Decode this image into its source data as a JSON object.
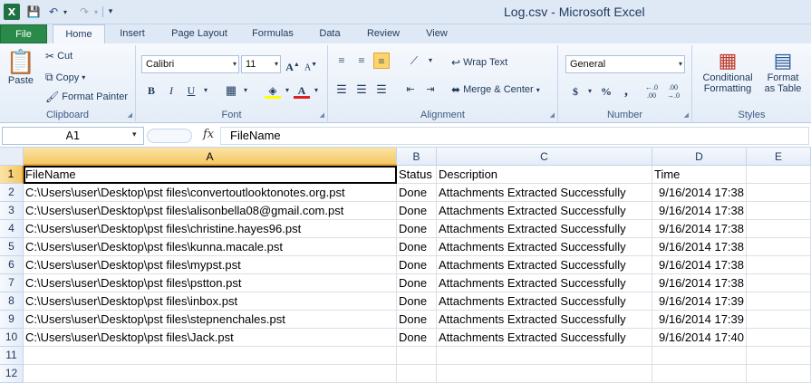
{
  "window": {
    "title": "Log.csv  -  Microsoft Excel",
    "app_icon": "X"
  },
  "qat": {
    "icons": [
      "excel-app-icon",
      "save-icon",
      "undo-icon",
      "redo-icon",
      "customize-qat-icon"
    ]
  },
  "tabs": [
    "File",
    "Home",
    "Insert",
    "Page Layout",
    "Formulas",
    "Data",
    "Review",
    "View"
  ],
  "ribbon": {
    "clipboard": {
      "label": "Clipboard",
      "paste": "Paste",
      "cut": "Cut",
      "copy": "Copy",
      "copy_arrow": "▾",
      "format_painter": "Format Painter"
    },
    "font": {
      "label": "Font",
      "name": "Calibri",
      "size": "11"
    },
    "alignment": {
      "label": "Alignment",
      "wrap_text": "Wrap Text",
      "merge_center": "Merge & Center"
    },
    "number": {
      "label": "Number",
      "format": "General"
    },
    "styles": {
      "label": "Styles",
      "conditional_formatting_1": "Conditional",
      "conditional_formatting_2": "Formatting",
      "format_table_1": "Format",
      "format_table_2": "as Table"
    }
  },
  "formula_bar": {
    "name_box": "A1",
    "fx": "fx",
    "value": "FileName"
  },
  "sheet": {
    "selected_cell": "A1",
    "columns": [
      "A",
      "B",
      "C",
      "D",
      "E"
    ],
    "row_numbers": [
      "1",
      "2",
      "3",
      "4",
      "5",
      "6",
      "7",
      "8",
      "9",
      "10",
      "11",
      "12"
    ],
    "rows": [
      [
        "FileName",
        "Status",
        "Description",
        "Time"
      ],
      [
        "C:\\Users\\user\\Desktop\\pst files\\convertoutlooktonotes.org.pst",
        "Done",
        "Attachments Extracted  Successfully",
        "9/16/2014 17:38"
      ],
      [
        "C:\\Users\\user\\Desktop\\pst files\\alisonbella08@gmail.com.pst",
        "Done",
        "Attachments Extracted  Successfully",
        "9/16/2014 17:38"
      ],
      [
        "C:\\Users\\user\\Desktop\\pst files\\christine.hayes96.pst",
        "Done",
        "Attachments Extracted  Successfully",
        "9/16/2014 17:38"
      ],
      [
        "C:\\Users\\user\\Desktop\\pst files\\kunna.macale.pst",
        "Done",
        "Attachments Extracted  Successfully",
        "9/16/2014 17:38"
      ],
      [
        "C:\\Users\\user\\Desktop\\pst files\\mypst.pst",
        "Done",
        "Attachments Extracted  Successfully",
        "9/16/2014 17:38"
      ],
      [
        "C:\\Users\\user\\Desktop\\pst files\\pstton.pst",
        "Done",
        "Attachments Extracted  Successfully",
        "9/16/2014 17:38"
      ],
      [
        "C:\\Users\\user\\Desktop\\pst files\\inbox.pst",
        "Done",
        "Attachments Extracted  Successfully",
        "9/16/2014 17:39"
      ],
      [
        "C:\\Users\\user\\Desktop\\pst files\\stepnenchales.pst",
        "Done",
        "Attachments Extracted  Successfully",
        "9/16/2014 17:39"
      ],
      [
        "C:\\Users\\user\\Desktop\\pst files\\Jack.pst",
        "Done",
        "Attachments Extracted  Successfully",
        "9/16/2014 17:40"
      ],
      [
        "",
        "",
        "",
        ""
      ],
      [
        "",
        "",
        "",
        ""
      ]
    ]
  }
}
